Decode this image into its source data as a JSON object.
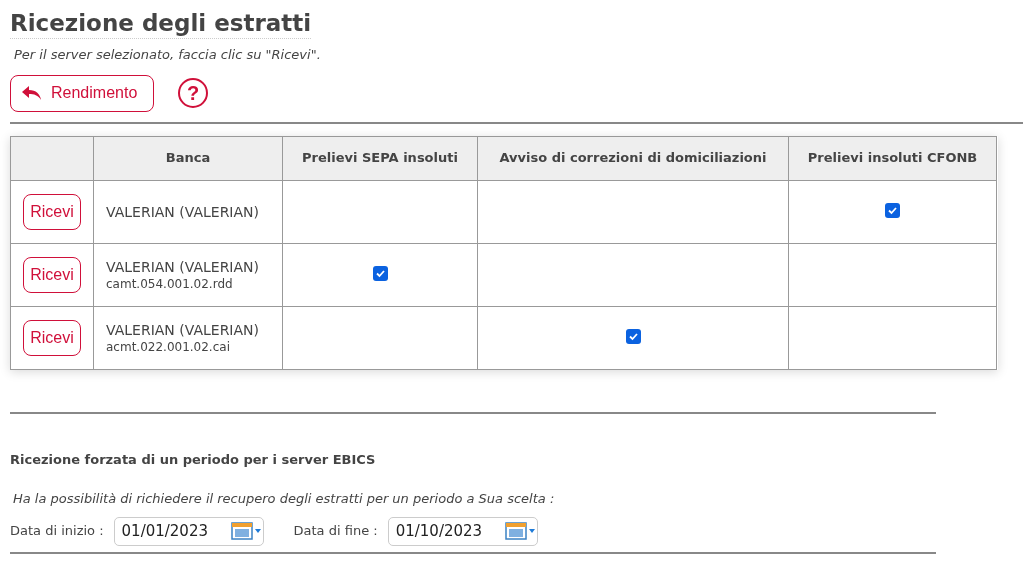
{
  "page": {
    "title": "Ricezione degli estratti",
    "subtitle": "Per il server selezionato, faccia clic su \"Ricevi\"."
  },
  "toolbar": {
    "back_button": "Rendimento",
    "help_button": "?"
  },
  "table": {
    "columns": [
      "Banca",
      "Prelievi SEPA insoluti",
      "Avviso di correzioni di domiciliazioni",
      "Prelievi insoluti CFONB"
    ],
    "rows": [
      {
        "action": "Ricevi",
        "bank": "VALERIAN (VALERIAN)",
        "checks": [
          {
            "checked": false
          },
          {
            "checked": false
          },
          {
            "checked": true
          }
        ]
      },
      {
        "action": "Ricevi",
        "bank": "VALERIAN (VALERIAN)",
        "file": "camt.054.001.02.rdd",
        "checks": [
          {
            "checked": true
          },
          {
            "checked": false
          },
          {
            "checked": false
          }
        ]
      },
      {
        "action": "Ricevi",
        "bank": "VALERIAN (VALERIAN)",
        "file": "acmt.022.001.02.cai",
        "checks": [
          {
            "checked": false
          },
          {
            "checked": true
          },
          {
            "checked": false
          }
        ]
      }
    ]
  },
  "forced": {
    "title": "Ricezione forzata di un periodo per i server EBICS",
    "note": "Ha la possibilità di richiedere il recupero degli estratti per un periodo a Sua scelta :",
    "fields": [
      {
        "label": "Data di inizio :",
        "value": "01/01/2023"
      },
      {
        "label": "Data di fine :",
        "value": "01/10/2023"
      }
    ]
  }
}
